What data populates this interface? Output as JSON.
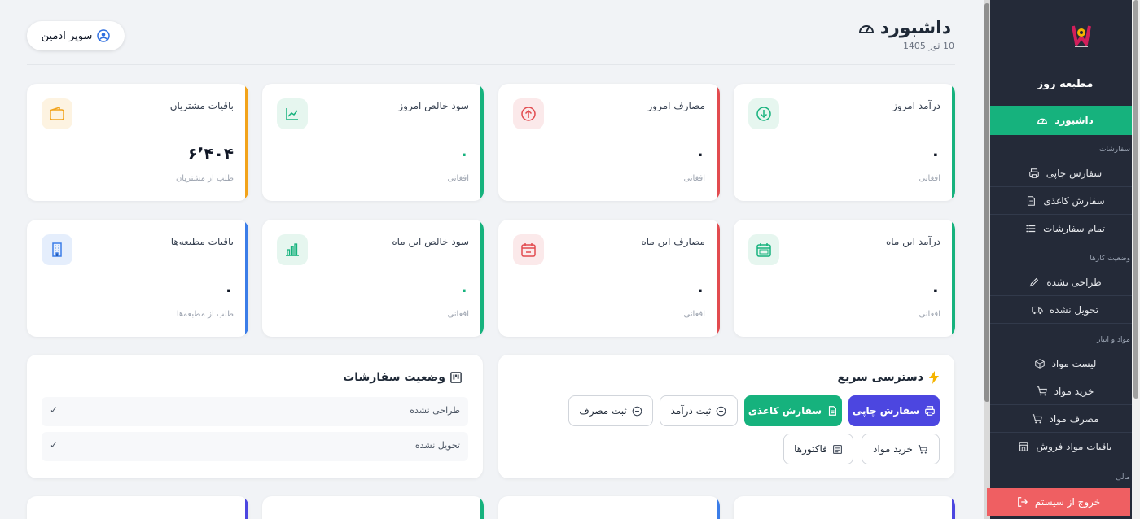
{
  "header": {
    "title": "داشبورد",
    "date": "10 ثور 1405",
    "user": "سوپر ادمین"
  },
  "sidebar": {
    "brand": "مطبعه روز",
    "dashboard": "داشبورد",
    "section_orders": "سفارشات",
    "orders": [
      "سفارش چاپی",
      "سفارش کاغذی",
      "تمام سفارشات"
    ],
    "section_status": "وضعیت کارها",
    "status_items": [
      "طراحی نشده",
      "تحویل نشده"
    ],
    "section_materials": "مواد و انبار",
    "materials": [
      "لیست مواد",
      "خرید مواد",
      "مصرف مواد",
      "باقیات مواد فروش"
    ],
    "section_finance": "مالی",
    "logout": "خروج از سیستم"
  },
  "cards_row1": [
    {
      "title": "درآمد امروز",
      "value": "۰",
      "sub": "افغانی",
      "color": "#16b27d",
      "icon": "download-circle-icon"
    },
    {
      "title": "مصارف امروز",
      "value": "۰",
      "sub": "افغانی",
      "color": "#e24b4f",
      "icon": "upload-circle-icon"
    },
    {
      "title": "سود خالص امروز",
      "value": "۰",
      "sub": "افغانی",
      "color": "#16b27d",
      "icon": "trend-up-icon"
    },
    {
      "title": "باقیات مشتریان",
      "value": "۶٬۴۰۴",
      "sub": "طلب از مشتریان",
      "color": "#f2a31b",
      "icon": "wallet-icon"
    }
  ],
  "cards_row2": [
    {
      "title": "درآمد این ماه",
      "value": "۰",
      "sub": "افغانی",
      "color": "#16b27d",
      "icon": "calendar-month-icon"
    },
    {
      "title": "مصارف این ماه",
      "value": "۰",
      "sub": "افغانی",
      "color": "#e24b4f",
      "icon": "calendar-minus-icon"
    },
    {
      "title": "سود خالص این ماه",
      "value": "۰",
      "sub": "افغانی",
      "color": "#16b27d",
      "icon": "bar-chart-icon"
    },
    {
      "title": "باقیات مطبعه‌ها",
      "value": "۰",
      "sub": "طلب از مطبعه‌ها",
      "color": "#3b7de8",
      "icon": "building-icon"
    }
  ],
  "quick": {
    "title": "دسترسی سریع",
    "buttons": [
      "سفارش چاپی",
      "سفارش کاغذی",
      "ثبت درآمد",
      "ثبت مصرف",
      "خرید مواد",
      "فاکتورها"
    ]
  },
  "order_status": {
    "title": "وضعیت سفارشات",
    "rows": [
      {
        "label": "طراحی نشده",
        "check": "✓"
      },
      {
        "label": "تحویل نشده",
        "check": "✓"
      }
    ]
  }
}
